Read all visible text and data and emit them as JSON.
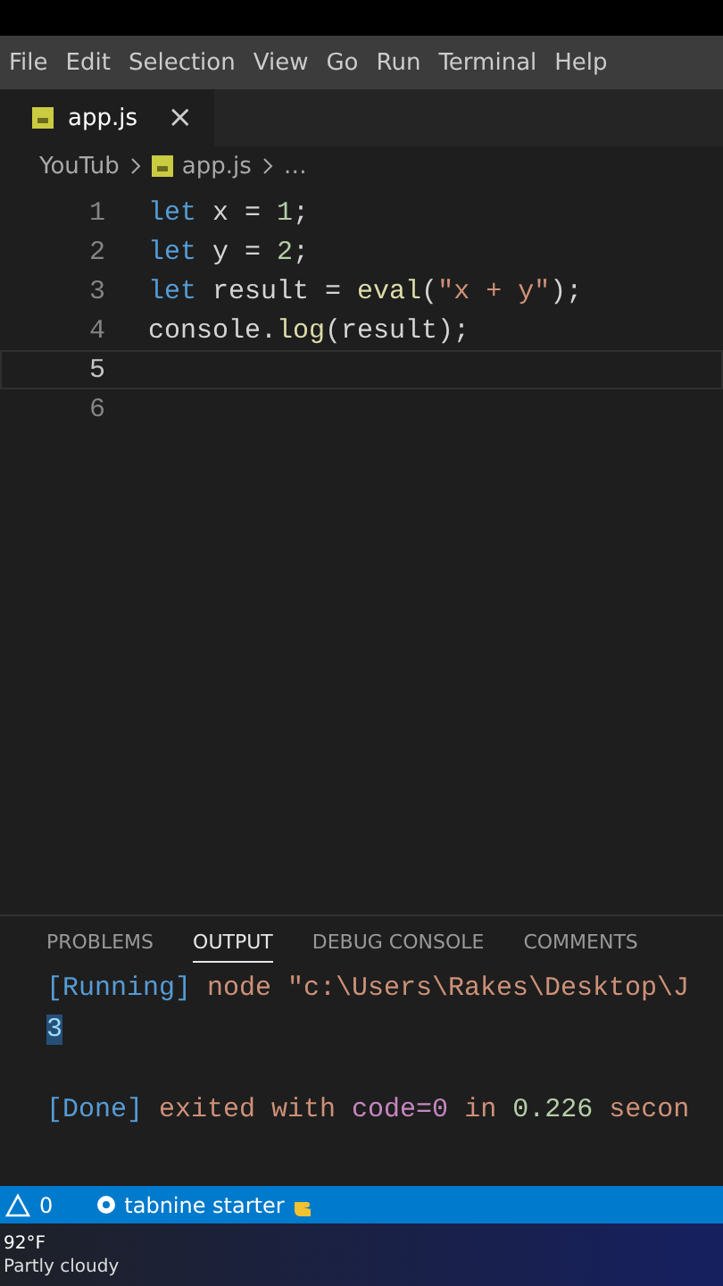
{
  "menu": [
    "File",
    "Edit",
    "Selection",
    "View",
    "Go",
    "Run",
    "Terminal",
    "Help"
  ],
  "tabs": [
    {
      "label": "app.js",
      "close": "×",
      "selected": true
    }
  ],
  "breadcrumb": [
    "YouTub",
    "app.js",
    "…"
  ],
  "editor": {
    "lines": [
      {
        "number": "1",
        "current": false,
        "tokens": [
          {
            "text": "let",
            "kind": "keyword"
          },
          {
            "text": " x = ",
            "kind": "plain"
          },
          {
            "text": "1",
            "kind": "number"
          },
          {
            "text": ";",
            "kind": "plain"
          }
        ]
      },
      {
        "number": "2",
        "current": false,
        "tokens": [
          {
            "text": "let",
            "kind": "keyword"
          },
          {
            "text": " y = ",
            "kind": "plain"
          },
          {
            "text": "2",
            "kind": "number"
          },
          {
            "text": ";",
            "kind": "plain"
          }
        ]
      },
      {
        "number": "3",
        "current": false,
        "tokens": [
          {
            "text": "let",
            "kind": "keyword"
          },
          {
            "text": " result = ",
            "kind": "plain"
          },
          {
            "text": "eval",
            "kind": "function"
          },
          {
            "text": "(",
            "kind": "plain"
          },
          {
            "text": "\"x + y\"",
            "kind": "string"
          },
          {
            "text": ");",
            "kind": "plain"
          }
        ]
      },
      {
        "number": "4",
        "current": false,
        "tokens": [
          {
            "text": "console",
            "kind": "plain"
          },
          {
            "text": ".",
            "kind": "plain"
          },
          {
            "text": "log",
            "kind": "function"
          },
          {
            "text": "(result);",
            "kind": "plain"
          }
        ]
      },
      {
        "number": "5",
        "current": true
      },
      {
        "number": "6",
        "current": false
      }
    ]
  },
  "panel": {
    "tabs": [
      {
        "label": "PROBLEMS",
        "selected": false
      },
      {
        "label": "OUTPUT",
        "selected": true
      },
      {
        "label": "DEBUG CONSOLE",
        "selected": false
      },
      {
        "label": "COMMENTS",
        "selected": false
      }
    ],
    "output": [
      {
        "tokens": [
          {
            "text": "[Running]",
            "kind": "tag"
          },
          {
            "text": " node \"c:\\Users\\Rakes\\Desktop\\J",
            "kind": "path"
          }
        ]
      },
      {
        "tokens": [
          {
            "text": "3",
            "kind": "selection"
          }
        ]
      },
      {
        "tokens": [
          {
            "text": "[Done]",
            "kind": "tag"
          },
          {
            "text": " exited with ",
            "kind": "path"
          },
          {
            "text": "code=0",
            "kind": "code"
          },
          {
            "text": " in ",
            "kind": "path"
          },
          {
            "text": "0.226",
            "kind": "number"
          },
          {
            "text": " secon",
            "kind": "path"
          }
        ]
      }
    ]
  },
  "status_bar": {
    "warnings": "0",
    "extension": "tabnine starter"
  },
  "taskbar": {
    "temperature": "92°F",
    "weather": "Partly cloudy"
  }
}
